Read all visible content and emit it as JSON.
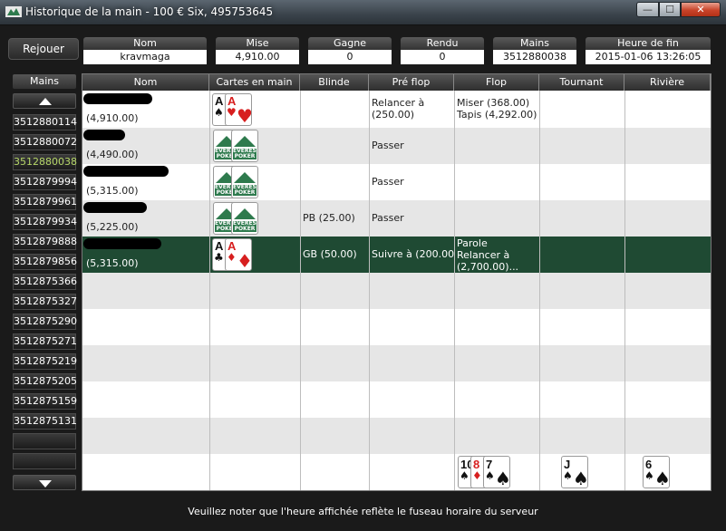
{
  "window": {
    "title": "Historique de la main - 100 € Six, 495753645",
    "min": "—",
    "max": "☐",
    "close": "✕"
  },
  "summary": {
    "replay": "Rejouer",
    "fields": [
      {
        "label": "Nom",
        "value": "kravmaga"
      },
      {
        "label": "Mise",
        "value": "4,910.00"
      },
      {
        "label": "Gagne",
        "value": "0"
      },
      {
        "label": "Rendu",
        "value": "0"
      },
      {
        "label": "Mains",
        "value": "3512880038"
      },
      {
        "label": "Heure de fin",
        "value": "2015-01-06 13:26:05"
      }
    ]
  },
  "hands_header": "Mains",
  "hands": [
    "3512880114",
    "3512880072",
    "3512880038",
    "3512879994",
    "3512879961",
    "3512879934",
    "3512879888",
    "3512879856",
    "3512875366",
    "3512875327",
    "3512875290",
    "3512875271",
    "3512875219",
    "3512875205",
    "3512875159",
    "3512875131"
  ],
  "selected_hand": "3512880038",
  "columns": [
    "Nom",
    "Cartes en main",
    "Blinde",
    "Pré flop",
    "Flop",
    "Tournant",
    "Rivière"
  ],
  "players": [
    {
      "stack": "(4,910.00)",
      "cards": [
        {
          "rank": "A",
          "suit": "♠",
          "color": "black"
        },
        {
          "rank": "A",
          "suit": "♥",
          "color": "red"
        }
      ],
      "blind": "",
      "preflop": "Relancer à\n(250.00)",
      "flop": "Miser (368.00)\nTapis (4,292.00)"
    },
    {
      "stack": "(4,490.00)",
      "cards": "hidden",
      "blind": "",
      "preflop": "Passer",
      "flop": ""
    },
    {
      "stack": "(5,315.00)",
      "cards": "hidden",
      "blind": "",
      "preflop": "Passer",
      "flop": ""
    },
    {
      "stack": "(5,225.00)",
      "cards": "hidden",
      "blind": "PB (25.00)",
      "preflop": "Passer",
      "flop": ""
    },
    {
      "stack": "(5,315.00)",
      "cards": [
        {
          "rank": "A",
          "suit": "♣",
          "color": "black"
        },
        {
          "rank": "A",
          "suit": "♦",
          "color": "red"
        }
      ],
      "blind": "GB (50.00)",
      "preflop": "Suivre à (200.00)",
      "flop": "Parole\nRelancer à\n(2,700.00)..."
    }
  ],
  "board": {
    "flop": [
      {
        "rank": "10",
        "suit": "♠",
        "color": "black"
      },
      {
        "rank": "8",
        "suit": "♦",
        "color": "red"
      },
      {
        "rank": "7",
        "suit": "♠",
        "color": "black"
      }
    ],
    "turn": {
      "rank": "J",
      "suit": "♠",
      "color": "black"
    },
    "river": {
      "rank": "6",
      "suit": "♠",
      "color": "black"
    }
  },
  "cardback_brand": "EVEREST\nPOKER",
  "footer": "Veuillez noter que l'heure affichée reflète le fuseau horaire du serveur"
}
